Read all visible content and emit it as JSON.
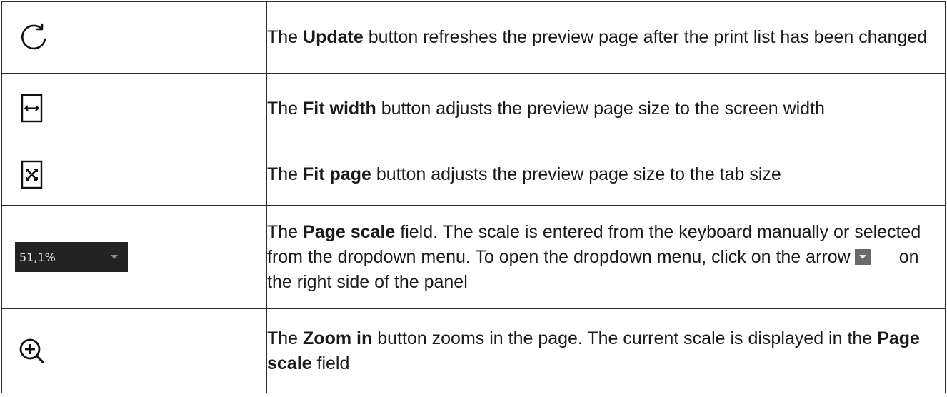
{
  "rows": [
    {
      "icon": "refresh-icon",
      "pre": "The ",
      "bold": "Update",
      "post": " button refreshes the preview page after the print list has been changed"
    },
    {
      "icon": "fit-width-icon",
      "pre": "The ",
      "bold": "Fit width",
      "post": " button adjusts the preview page size to the screen width"
    },
    {
      "icon": "fit-page-icon",
      "pre": "The ",
      "bold": "Fit page",
      "post": " button adjusts the preview page size to the tab size"
    },
    {
      "icon": "page-scale-field",
      "scale_value": "51,1%",
      "pre": "The ",
      "bold": "Page scale",
      "post": " field. The scale is entered from the keyboard manually or selected from the dropdown menu. To open the dropdown menu, click on the arrow",
      "post2": "on the right side of the panel"
    },
    {
      "icon": "zoom-in-icon",
      "pre": "The ",
      "bold": "Zoom in",
      "post": " button zooms in the page. The current scale is displayed in the ",
      "bold2": "Page scale",
      "post2": " field"
    }
  ]
}
